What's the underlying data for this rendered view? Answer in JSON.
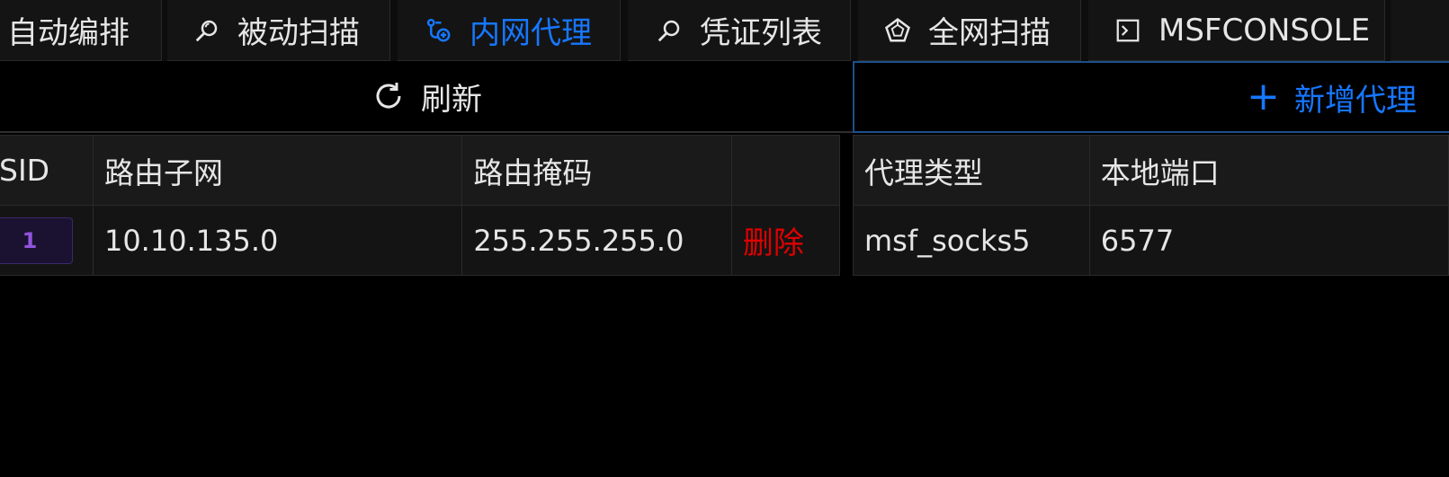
{
  "tabs": [
    {
      "label": "自动编排",
      "icon": "none",
      "active": false
    },
    {
      "label": "被动扫描",
      "icon": "search-icon",
      "active": false
    },
    {
      "label": "内网代理",
      "icon": "proxy-icon",
      "active": true
    },
    {
      "label": "凭证列表",
      "icon": "search-icon",
      "active": false
    },
    {
      "label": "全网扫描",
      "icon": "pentagon-icon",
      "active": false
    },
    {
      "label": "MSFCONSOLE",
      "icon": "terminal-icon",
      "active": false
    }
  ],
  "route_panel": {
    "refresh_label": "刷新",
    "columns": [
      "SID",
      "路由子网",
      "路由掩码",
      ""
    ],
    "rows": [
      {
        "sid": "1",
        "subnet": "10.10.135.0",
        "mask": "255.255.255.0",
        "action": "删除"
      }
    ]
  },
  "proxy_panel": {
    "add_label": "新增代理",
    "columns": [
      "代理类型",
      "本地端口"
    ],
    "rows": [
      {
        "type": "msf_socks5",
        "port": "6577"
      }
    ]
  },
  "colors": {
    "accent": "#1677ff",
    "danger": "#e00000",
    "sid_tag": "#9254de",
    "background": "#000000"
  }
}
